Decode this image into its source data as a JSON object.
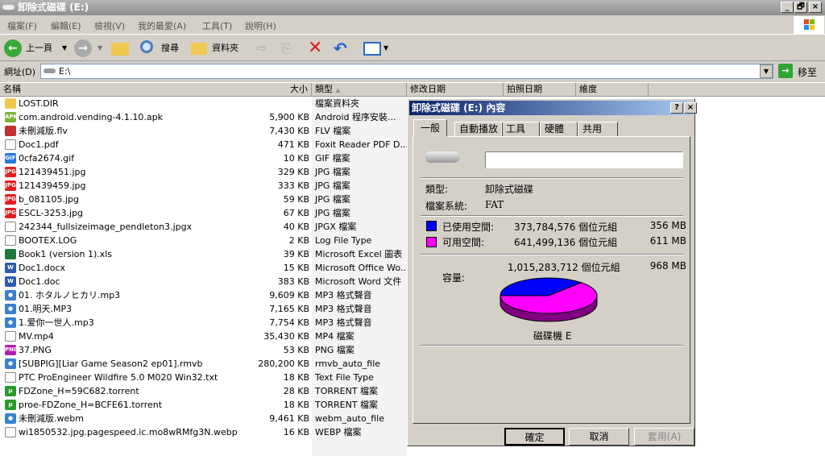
{
  "window": {
    "title": "卸除式磁碟 (E:)",
    "min": "_",
    "max": "🗗",
    "close": "×"
  },
  "menu": [
    "檔案(F)",
    "編輯(E)",
    "檢視(V)",
    "我的最愛(A)",
    "工具(T)",
    "說明(H)"
  ],
  "toolbar": {
    "back": "上一頁",
    "search": "搜尋",
    "folders": "資料夾"
  },
  "address": {
    "label": "網址(D)",
    "value": "E:\\",
    "go": "移至"
  },
  "columns": [
    "名稱",
    "大小",
    "類型",
    "修改日期",
    "拍照日期",
    "維度"
  ],
  "files": [
    {
      "name": "LOST.DIR",
      "size": "",
      "type": "檔案資料夾",
      "icon": "folder"
    },
    {
      "name": "com.android.vending-4.1.10.apk",
      "size": "5,900 KB",
      "type": "Android 程序安裝...",
      "icon": "apk"
    },
    {
      "name": "未刪減版.flv",
      "size": "7,430 KB",
      "type": "FLV 檔案",
      "icon": "flv"
    },
    {
      "name": "Doc1.pdf",
      "size": "471 KB",
      "type": "Foxit Reader PDF D...",
      "icon": "pdf"
    },
    {
      "name": "0cfa2674.gif",
      "size": "10 KB",
      "type": "GIF 檔案",
      "icon": "gif"
    },
    {
      "name": "121439451.jpg",
      "size": "329 KB",
      "type": "JPG 檔案",
      "icon": "jpg"
    },
    {
      "name": "121439459.jpg",
      "size": "333 KB",
      "type": "JPG 檔案",
      "icon": "jpg"
    },
    {
      "name": "b_081105.jpg",
      "size": "59 KB",
      "type": "JPG 檔案",
      "icon": "jpg"
    },
    {
      "name": "ESCL-3253.jpg",
      "size": "67 KB",
      "type": "JPG 檔案",
      "icon": "jpg"
    },
    {
      "name": "242344_fullsizeimage_pendleton3.jpgx",
      "size": "40 KB",
      "type": "JPGX 檔案",
      "icon": "jpgx"
    },
    {
      "name": "BOOTEX.LOG",
      "size": "2 KB",
      "type": "Log File Type",
      "icon": "generic"
    },
    {
      "name": "Book1 (version 1).xls",
      "size": "39 KB",
      "type": "Microsoft Excel 圖表",
      "icon": "xls"
    },
    {
      "name": "Doc1.docx",
      "size": "15 KB",
      "type": "Microsoft Office Wo...",
      "icon": "doc"
    },
    {
      "name": "Doc1.doc",
      "size": "383 KB",
      "type": "Microsoft Word 文件",
      "icon": "doc"
    },
    {
      "name": "01. ホタルノヒカリ.mp3",
      "size": "9,609 KB",
      "type": "MP3 格式聲音",
      "icon": "media"
    },
    {
      "name": "01.明天.MP3",
      "size": "7,165 KB",
      "type": "MP3 格式聲音",
      "icon": "media"
    },
    {
      "name": "1.爱你一世人.mp3",
      "size": "7,754 KB",
      "type": "MP3 格式聲音",
      "icon": "media"
    },
    {
      "name": "MV.mp4",
      "size": "35,430 KB",
      "type": "MP4 檔案",
      "icon": "generic"
    },
    {
      "name": "37.PNG",
      "size": "53 KB",
      "type": "PNG 檔案",
      "icon": "png"
    },
    {
      "name": "[SUBPIG][Liar Game Season2 ep01].rmvb",
      "size": "280,200 KB",
      "type": "rmvb_auto_file",
      "icon": "media"
    },
    {
      "name": "PTC ProEngineer Wildfire 5.0 M020 Win32.txt",
      "size": "18 KB",
      "type": "Text File Type",
      "icon": "txt"
    },
    {
      "name": "FDZone_H=59C682.torrent",
      "size": "28 KB",
      "type": "TORRENT 檔案",
      "icon": "torrent"
    },
    {
      "name": "proe-FDZone_H=BCFE61.torrent",
      "size": "18 KB",
      "type": "TORRENT 檔案",
      "icon": "torrent"
    },
    {
      "name": "未刪減版.webm",
      "size": "9,461 KB",
      "type": "webm_auto_file",
      "icon": "media"
    },
    {
      "name": "wi1850532.jpg.pagespeed.ic.mo8wRMfg3N.webp",
      "size": "16 KB",
      "type": "WEBP 檔案",
      "icon": "generic"
    }
  ],
  "dialog": {
    "title": "卸除式磁碟 (E:) 內容",
    "help": "?",
    "close": "×",
    "tabs": [
      "一般",
      "自動播放",
      "工具",
      "硬體",
      "共用"
    ],
    "label_value": "",
    "type_label": "類型:",
    "type_value": "卸除式磁碟",
    "fs_label": "檔案系統:",
    "fs_value": "FAT",
    "used_label": "已使用空間:",
    "used_bytes": "373,784,576 個位元組",
    "used_mb": "356 MB",
    "free_label": "可用空間:",
    "free_bytes": "641,499,136 個位元組",
    "free_mb": "611 MB",
    "cap_label": "容量:",
    "cap_bytes": "1,015,283,712 個位元組",
    "cap_mb": "968 MB",
    "drive_label": "磁碟機 E",
    "ok": "確定",
    "cancel": "取消",
    "apply": "套用(A)",
    "used_color": "#0000ff",
    "free_color": "#ff00ff",
    "used_fraction": 0.368
  }
}
